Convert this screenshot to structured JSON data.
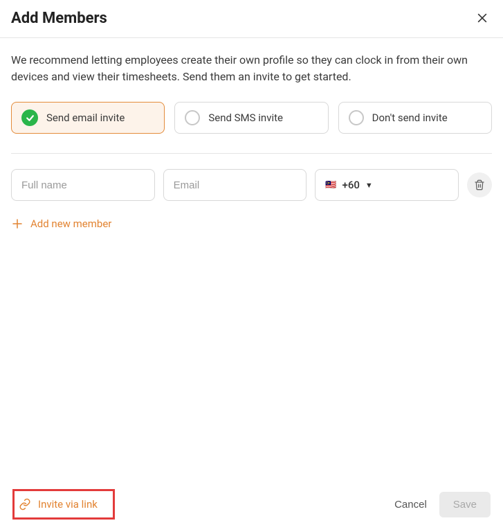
{
  "header": {
    "title": "Add Members"
  },
  "description": "We recommend letting employees create their own profile so they can clock in from their own devices and view their timesheets. Send them an invite to get started.",
  "inviteOptions": {
    "email": "Send email invite",
    "sms": "Send SMS invite",
    "none": "Don't send invite"
  },
  "memberForm": {
    "fullNamePlaceholder": "Full name",
    "emailPlaceholder": "Email",
    "phoneCountryFlag": "🇲🇾",
    "phoneCountryCode": "+60"
  },
  "actions": {
    "addNewMember": "Add new member",
    "inviteViaLink": "Invite via link",
    "cancel": "Cancel",
    "save": "Save"
  }
}
